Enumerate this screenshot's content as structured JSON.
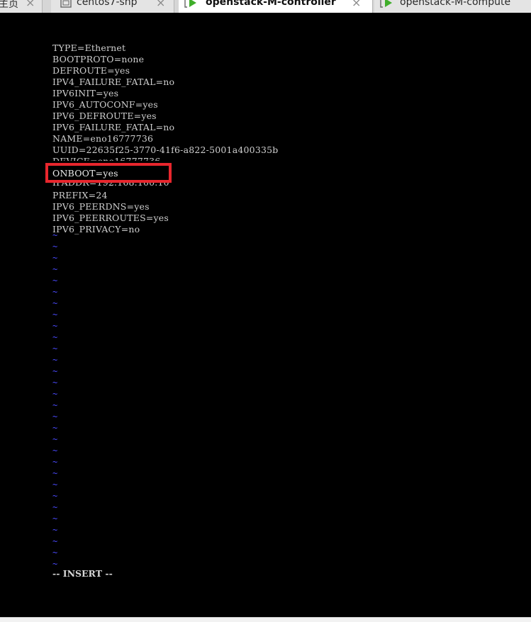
{
  "tabs": [
    {
      "label": "主页",
      "active": false,
      "icon": "none"
    },
    {
      "label": "centos7-snp",
      "active": false,
      "icon": "vm-icon"
    },
    {
      "label": "openstack-M-controller",
      "active": true,
      "icon": "vm-running-icon"
    },
    {
      "label": "openstack-M-compute",
      "active": false,
      "icon": "vm-running-icon"
    }
  ],
  "close_glyph": "×",
  "file_lines": [
    "TYPE=Ethernet",
    "BOOTPROTO=none",
    "DEFROUTE=yes",
    "IPV4_FAILURE_FATAL=no",
    "IPV6INIT=yes",
    "IPV6_AUTOCONF=yes",
    "IPV6_DEFROUTE=yes",
    "IPV6_FAILURE_FATAL=no",
    "NAME=eno16777736",
    "UUID=22635f25-3770-41f6-a822-5001a400335b",
    "DEVICE=eno16777736",
    "ONBOOT=yes",
    "IPADDR=192.168.100.10",
    "PREFIX=24",
    "IPV6_PEERDNS=yes",
    "IPV6_PEERROUTES=yes",
    "IPV6_PRIVACY=no"
  ],
  "highlighted_line": "ONBOOT=yes",
  "tilde_glyph": "~",
  "tilde_count": 30,
  "mode_status": "-- INSERT --",
  "colors": {
    "terminal_bg": "#000000",
    "text": "#cfcfcf",
    "tilde": "#4a4aff",
    "highlight": "#e8262d",
    "tab_icon_green": "#3fae2a"
  }
}
